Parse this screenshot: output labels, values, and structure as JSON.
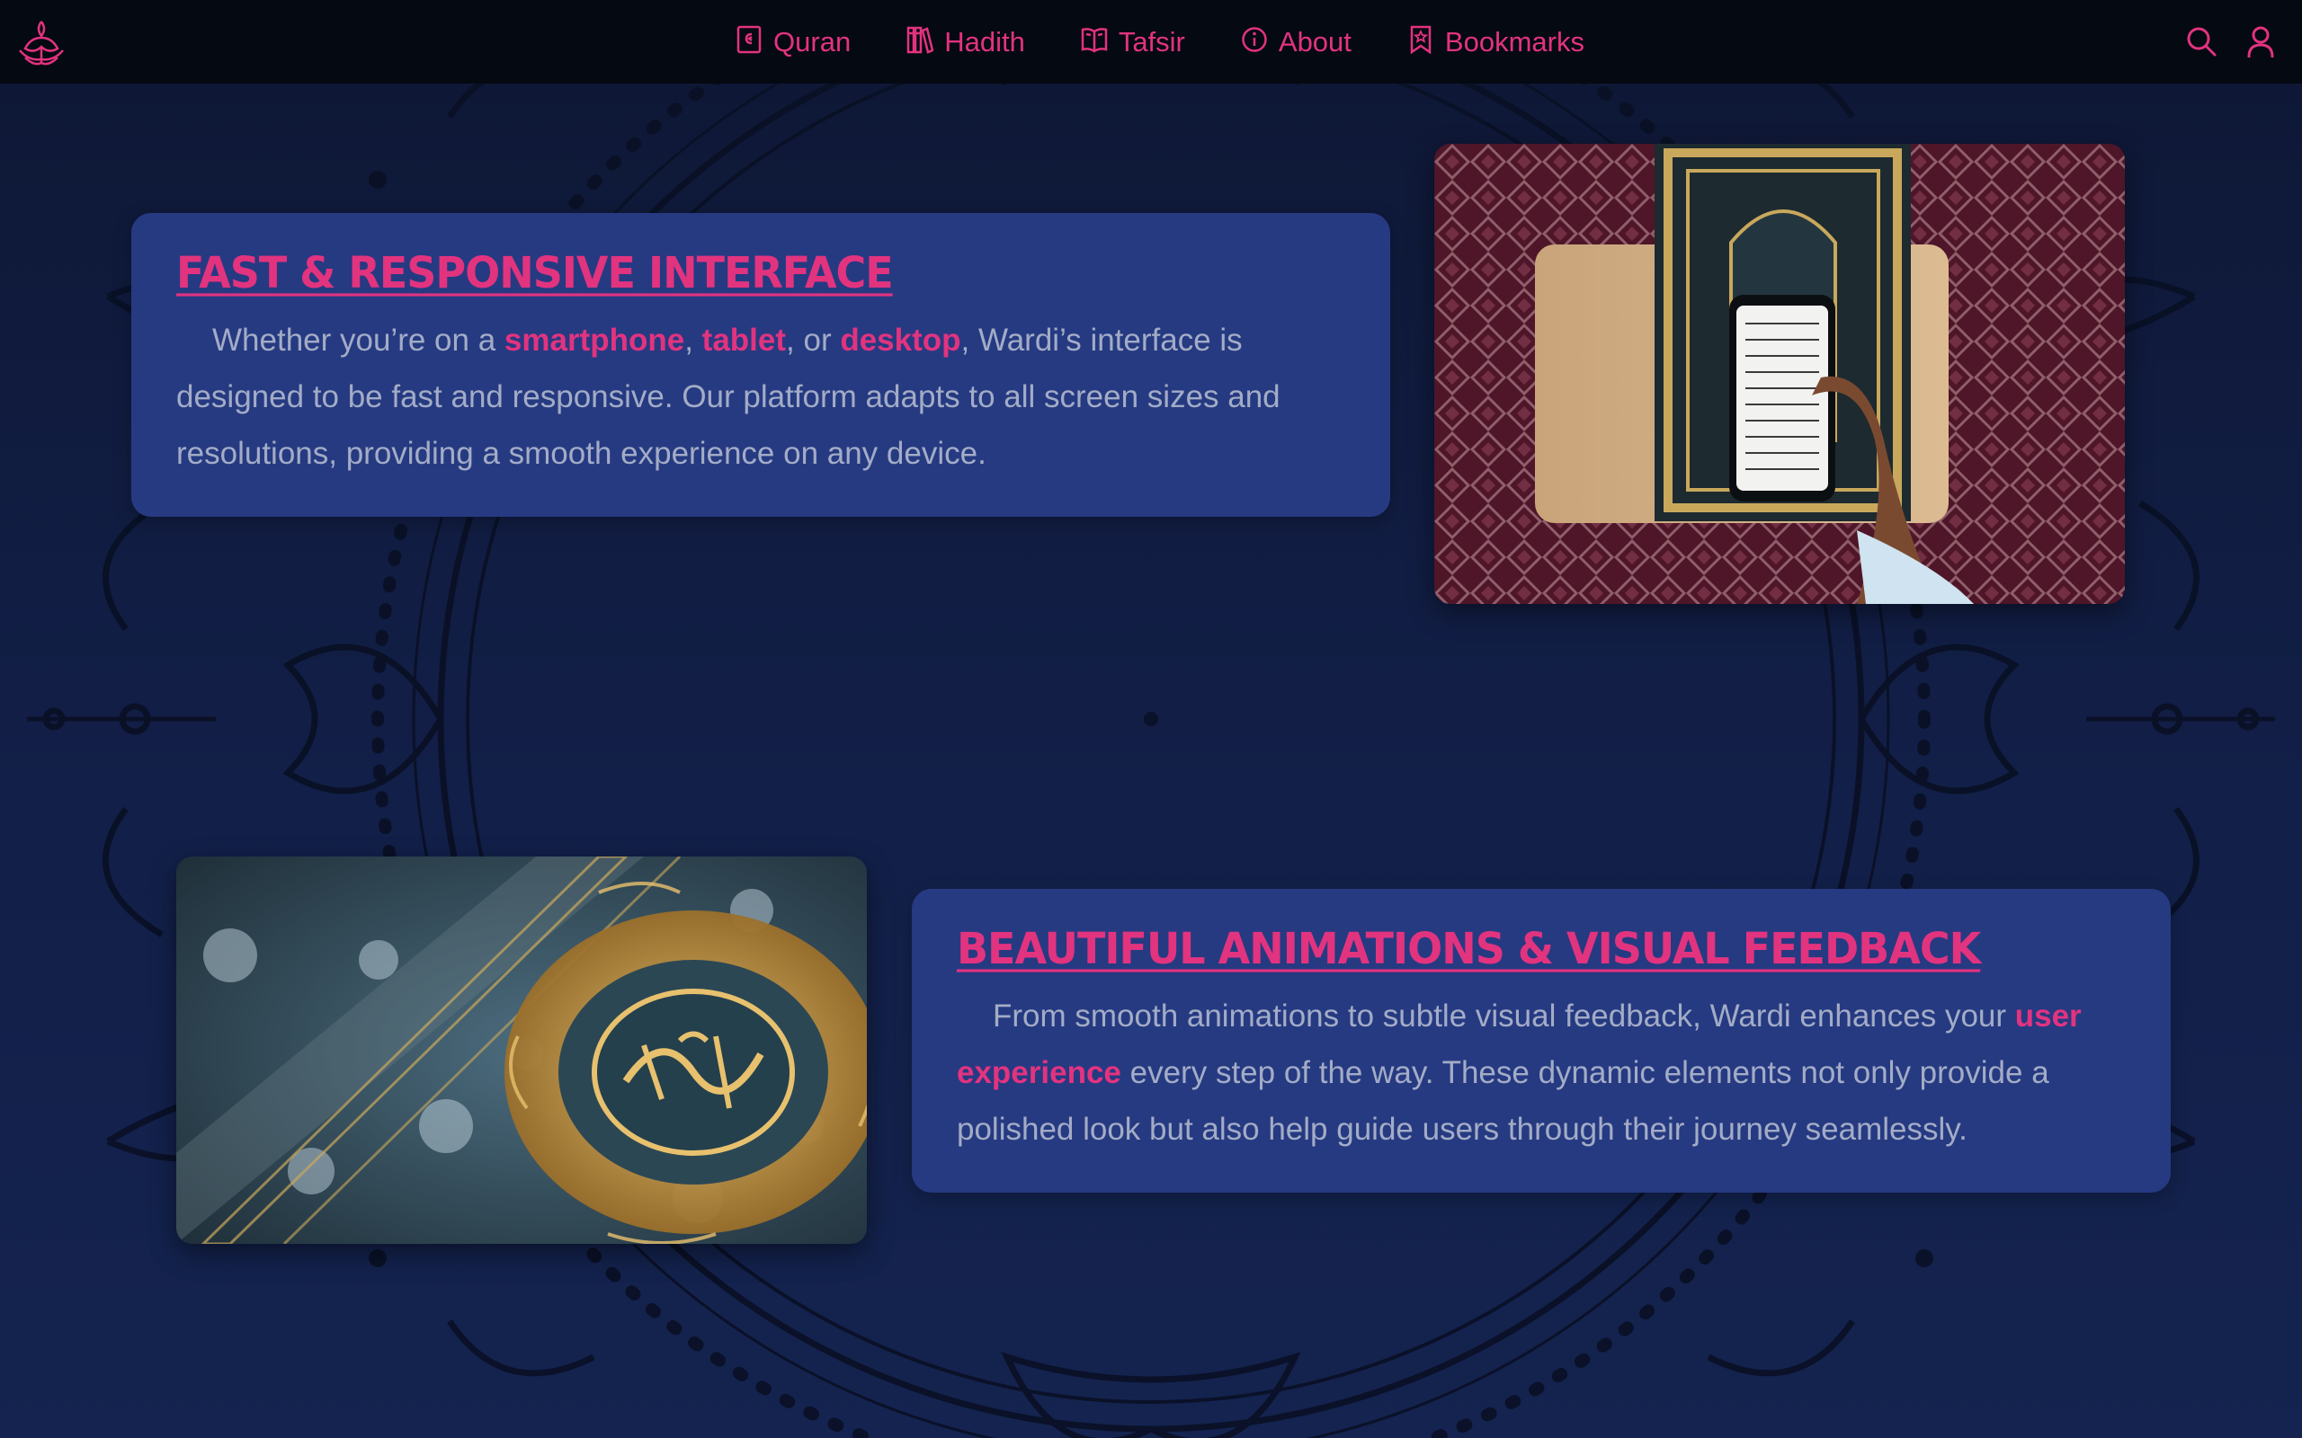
{
  "nav": {
    "items": [
      {
        "label": "Quran",
        "icon": "quran-icon"
      },
      {
        "label": "Hadith",
        "icon": "books-icon"
      },
      {
        "label": "Tafsir",
        "icon": "open-book-icon"
      },
      {
        "label": "About",
        "icon": "info-icon"
      },
      {
        "label": "Bookmarks",
        "icon": "bookmark-icon"
      }
    ],
    "right_icons": [
      "search-icon",
      "user-icon"
    ],
    "logo": "lotus-logo-icon"
  },
  "sections": [
    {
      "title": "Fast & Responsive Interface",
      "body": [
        {
          "text": "Whether you’re on a ",
          "hl": false
        },
        {
          "text": "smartphone",
          "hl": true
        },
        {
          "text": ", ",
          "hl": false
        },
        {
          "text": "tablet",
          "hl": true
        },
        {
          "text": ", or ",
          "hl": false
        },
        {
          "text": "desktop",
          "hl": true
        },
        {
          "text": ", Wardi’s interface is designed to be fast and responsive. Our platform adapts to all screen sizes and resolutions, providing a smooth experience on any device.",
          "hl": false
        }
      ],
      "image": "quran-and-phone-photo"
    },
    {
      "title": "Beautiful Animations & Visual Feedback",
      "body": [
        {
          "text": "From smooth animations to subtle visual feedback, Wardi enhances your ",
          "hl": false
        },
        {
          "text": "user experience",
          "hl": true
        },
        {
          "text": " every step of the way. These dynamic elements not only provide a polished look but also help guide users through their journey seamlessly.",
          "hl": false
        }
      ],
      "image": "golden-quran-cover-photo"
    }
  ],
  "colors": {
    "accent": "#e2337f",
    "navbar": "#050912",
    "background": "#121f48",
    "card": "#263a82",
    "body_text": "#a3acc6"
  }
}
